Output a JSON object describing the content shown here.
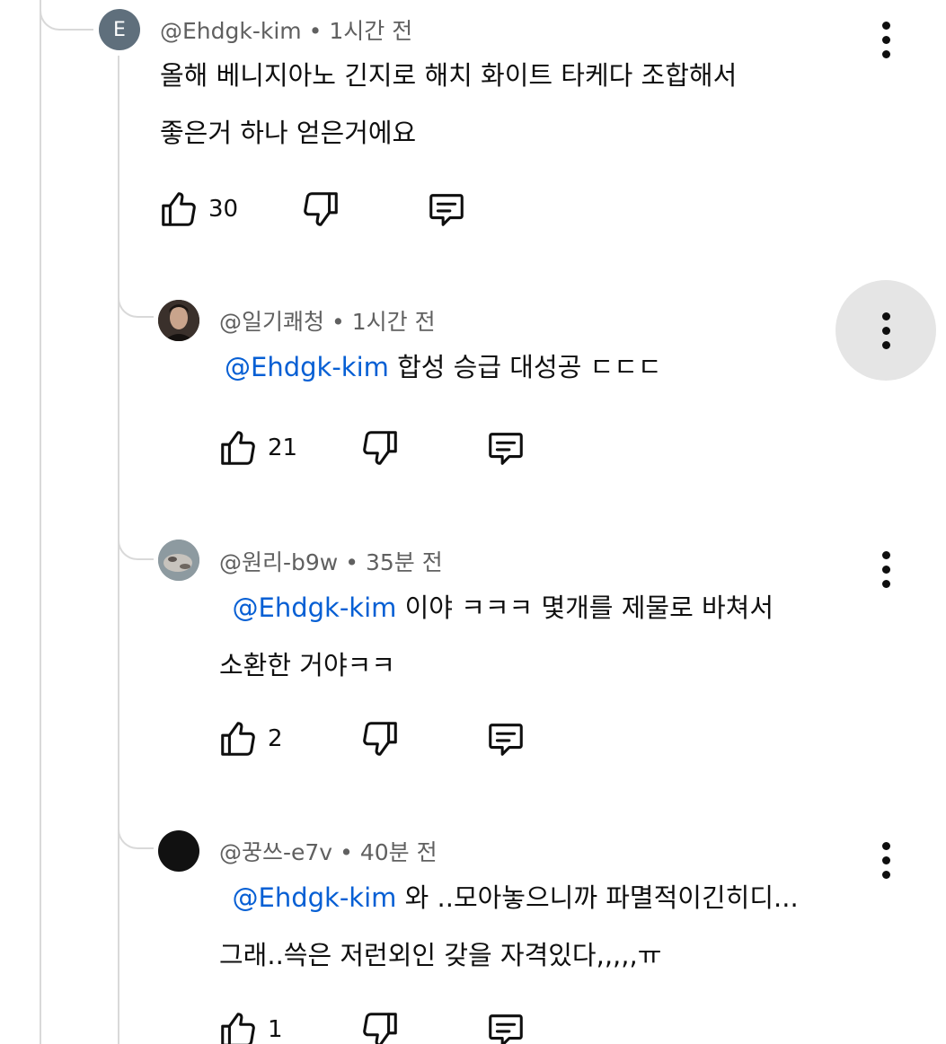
{
  "comments": [
    {
      "author": "@Ehdgk-kim",
      "time": "1시간 전",
      "avatar_letter": "E",
      "mention": "",
      "lines": [
        "올해 베니지아노 긴지로 해치 화이트 타케다 조합해서",
        "좋은거 하나 얻은거에요"
      ],
      "likes": "30"
    },
    {
      "author": "@일기쾌청",
      "time": "1시간 전",
      "mention": "@Ehdgk-kim",
      "lines": [
        " 합성 승급 대성공 ㄷㄷㄷ"
      ],
      "likes": "21"
    },
    {
      "author": "@원리-b9w",
      "time": "35분 전",
      "mention": "@Ehdgk-kim",
      "lines": [
        "  이야 ㅋㅋㅋ 몇개를 제물로 바쳐서",
        "소환한 거야ㅋㅋ"
      ],
      "likes": "2"
    },
    {
      "author": "@꿍쓰-e7v",
      "time": "40분 전",
      "mention": "@Ehdgk-kim",
      "lines": [
        " 와 ..모아놓으니까 파멸적이긴히디...",
        "그래..쓱은 저런외인 갖을 자격있다,,,,,ㅠ"
      ],
      "likes": "1"
    }
  ],
  "icons": {
    "like": "thumbs-up-icon",
    "dislike": "thumbs-down-icon",
    "reply": "comment-reply-icon",
    "more": "more-vertical-icon"
  },
  "colors": {
    "mention": "#065fd4",
    "meta": "#606060",
    "highlight": "#e5e5e5"
  }
}
